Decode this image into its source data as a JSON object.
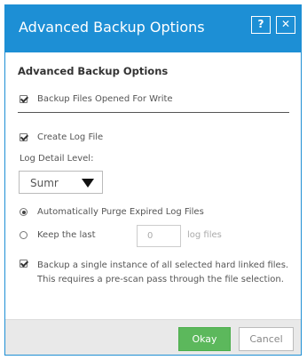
{
  "dialog": {
    "title": "Advanced Backup Options",
    "help_label": "?",
    "close_label": "✕"
  },
  "section": {
    "heading": "Advanced Backup Options"
  },
  "options": {
    "backup_open_files": {
      "label": "Backup Files Opened For Write",
      "checked": true
    },
    "create_log_file": {
      "label": "Create Log File",
      "checked": true
    },
    "log_detail_label": "Log Detail Level:",
    "log_detail_value": "Sumr",
    "purge_logs": {
      "label": "Automatically Purge Expired Log Files",
      "selected": true
    },
    "keep_last": {
      "label": "Keep the last",
      "value": "0",
      "unit": "log files",
      "selected": false
    },
    "hard_links": {
      "label": "Backup a single instance of all selected hard linked files. This requires a pre-scan pass through the file selection.",
      "checked": true
    }
  },
  "footer": {
    "okay_label": "Okay",
    "cancel_label": "Cancel"
  },
  "colors": {
    "titlebar": "#1d8fd5",
    "okay_button": "#5cb85c",
    "footer_bg": "#e9e9e9"
  }
}
